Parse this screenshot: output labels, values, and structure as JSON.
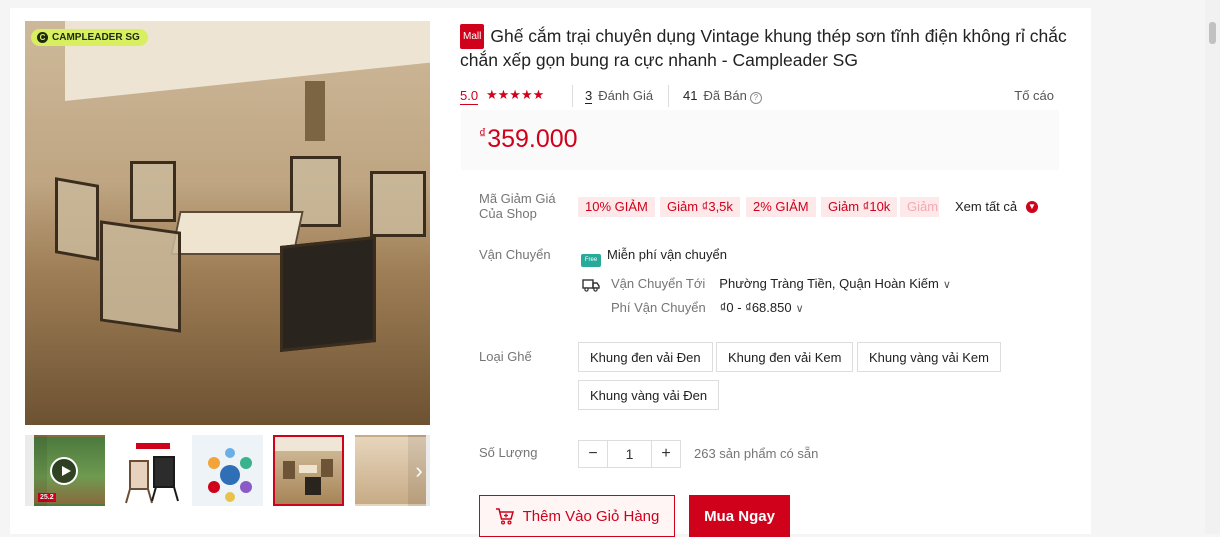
{
  "product": {
    "badge": "Mall",
    "title": "Ghế cắm trại chuyên dụng Vintage khung thép sơn tĩnh điện không rỉ chắc chắn xếp gọn bung ra cực nhanh - Campleader SG",
    "brand_logo": "CAMPLEADER SG",
    "rating": "5.0",
    "stars": "★★★★★",
    "review_count": "3",
    "review_label": "Đánh Giá",
    "sold_count": "41",
    "sold_label": "Đã Bán",
    "report_label": "Tố cáo",
    "price_currency": "₫",
    "price": "359.000"
  },
  "thumbnails": {
    "sale_tag": "25.2"
  },
  "vouchers": {
    "label": "Mã Giảm Giá\nCủa Shop",
    "items": [
      "10% GIẢM",
      "Giảm ₫3,5k",
      "2% GIẢM",
      "Giảm ₫10k",
      "Giảm"
    ],
    "see_all": "Xem tất cả"
  },
  "shipping": {
    "label": "Vận Chuyển",
    "free_label": "Miễn phí vận chuyển",
    "free_icon_text": "Free",
    "to_label": "Vận Chuyển Tới",
    "to_value": "Phường Tràng Tiền, Quận Hoàn Kiếm",
    "fee_label": "Phí Vận Chuyển",
    "fee_value": "₫0 - ₫68.850"
  },
  "variants": {
    "label": "Loại Ghế",
    "options": [
      "Khung đen vải Đen",
      "Khung đen vải Kem",
      "Khung vàng vải Kem",
      "Khung vàng vải Đen"
    ]
  },
  "quantity": {
    "label": "Số Lượng",
    "minus": "−",
    "value": "1",
    "plus": "+",
    "stock_text": "263 sản phẩm có sẵn"
  },
  "actions": {
    "add_to_cart": "Thêm Vào Giỏ Hàng",
    "buy_now": "Mua Ngay"
  },
  "colors": {
    "accent": "#d0011b",
    "voucher_bg": "#fde8ea"
  }
}
